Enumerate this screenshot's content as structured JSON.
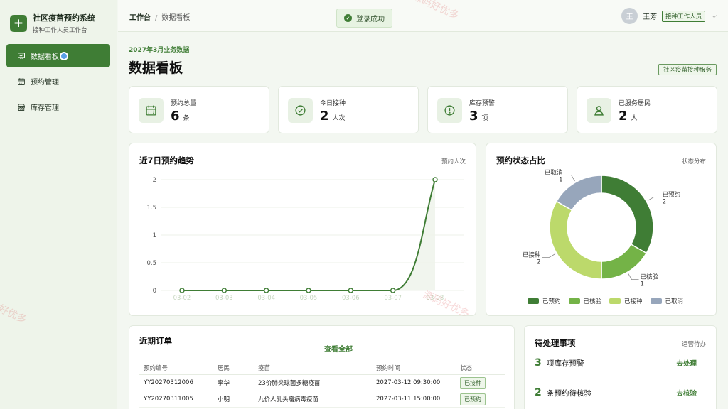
{
  "app": {
    "title": "社区疫苗预约系统",
    "subtitle": "接种工作人员工作台",
    "logo_glyph": "+"
  },
  "sidebar": {
    "items": [
      {
        "label": "数据看板",
        "icon": "presentation-chart-icon",
        "active": true
      },
      {
        "label": "预约管理",
        "icon": "calendar-icon",
        "active": false
      },
      {
        "label": "库存管理",
        "icon": "store-icon",
        "active": false
      }
    ]
  },
  "topbar": {
    "breadcrumb": [
      "工作台",
      "数据看板"
    ],
    "breadcrumb_sep": "/",
    "toast": "登录成功",
    "user": {
      "avatar": "王",
      "name": "王芳",
      "role": "接种工作人员"
    }
  },
  "header": {
    "eyebrow": "2027年3月业务数据",
    "title": "数据看板",
    "tag": "社区疫苗接种服务"
  },
  "stats": [
    {
      "label": "预约总量",
      "value": "6",
      "unit": "条",
      "icon": "calendar-icon"
    },
    {
      "label": "今日接种",
      "value": "2",
      "unit": "人次",
      "icon": "check-circle-icon"
    },
    {
      "label": "库存预警",
      "value": "3",
      "unit": "项",
      "icon": "alert-circle-icon"
    },
    {
      "label": "已服务居民",
      "value": "2",
      "unit": "人",
      "icon": "user-icon"
    }
  ],
  "trend": {
    "title": "近7日预约趋势",
    "aux": "预约人次"
  },
  "status": {
    "title": "预约状态占比",
    "aux": "状态分布"
  },
  "chart_data": [
    {
      "type": "line",
      "title": "近7日预约趋势",
      "categories": [
        "03-02",
        "03-03",
        "03-04",
        "03-05",
        "03-06",
        "03-07",
        "03-08"
      ],
      "values": [
        0,
        0,
        0,
        0,
        0,
        0,
        2
      ],
      "yticks": [
        "0",
        "0.5",
        "1",
        "1.5",
        "2"
      ],
      "ylim": [
        0,
        2
      ],
      "grid": true,
      "color": "#3f7d35"
    },
    {
      "type": "pie",
      "title": "预约状态占比",
      "donut": true,
      "slices": [
        {
          "name": "已预约",
          "value": 2,
          "color": "#3f7d35"
        },
        {
          "name": "已核验",
          "value": 1,
          "color": "#74b347"
        },
        {
          "name": "已接种",
          "value": 2,
          "color": "#bcd96b"
        },
        {
          "name": "已取消",
          "value": 1,
          "color": "#97a6bb"
        }
      ],
      "legend": "bottom"
    }
  ],
  "orders": {
    "title": "近期订单",
    "view_all": "查看全部",
    "columns": [
      "预约编号",
      "居民",
      "疫苗",
      "预约时间",
      "状态"
    ],
    "rows": [
      {
        "id": "YY20270312006",
        "resident": "李华",
        "vaccine": "23价肺炎球菌多糖疫苗",
        "time": "2027-03-12 09:30:00",
        "status": "已接种"
      },
      {
        "id": "YY20270311005",
        "resident": "小明",
        "vaccine": "九价人乳头瘤病毒疫苗",
        "time": "2027-03-11 15:00:00",
        "status": "已预约"
      }
    ]
  },
  "todo": {
    "title": "待处理事项",
    "aux": "运营待办",
    "items": [
      {
        "count": "3",
        "text": "项库存预警",
        "action": "去处理"
      },
      {
        "count": "2",
        "text": "条预约待核验",
        "action": "去核验"
      }
    ]
  },
  "watermark": "源码好优多",
  "colors": {
    "accent": "#3f7d35",
    "accent_light": "#eef6ea",
    "background": "#f3f7f1"
  }
}
